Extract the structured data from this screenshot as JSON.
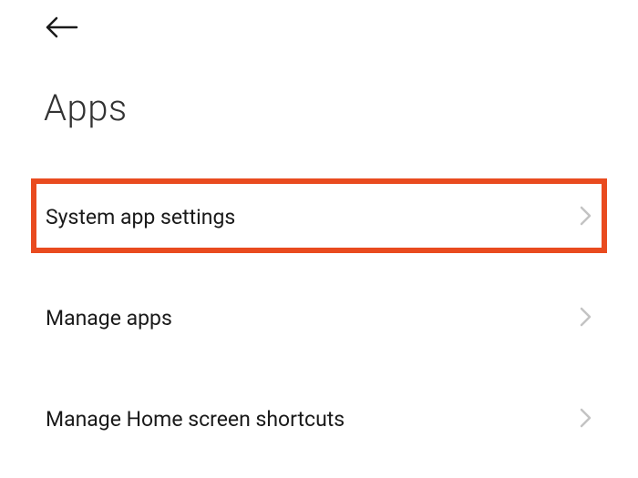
{
  "header": {
    "title": "Apps"
  },
  "settings": {
    "items": [
      {
        "label": "System app settings",
        "highlighted": true
      },
      {
        "label": "Manage apps",
        "highlighted": false
      },
      {
        "label": "Manage Home screen shortcuts",
        "highlighted": false
      }
    ]
  },
  "icons": {
    "back": "back-arrow",
    "chevron": "chevron-right"
  },
  "colors": {
    "highlight": "#e94b1f"
  }
}
